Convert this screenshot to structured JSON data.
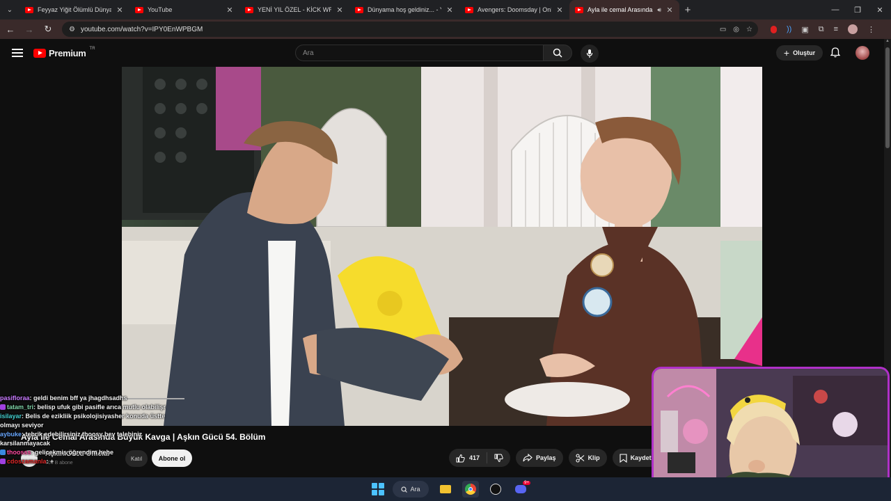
{
  "browser": {
    "tabs": [
      {
        "title": "Feyyaz Yiğit Ölümlü Dünya Sah",
        "active": false
      },
      {
        "title": "YouTube",
        "active": false
      },
      {
        "title": "YENİ YIL ÖZEL - KİCK WRAPPED",
        "active": false
      },
      {
        "title": "Dünyama hoş geldiniz... - YouTu",
        "active": false
      },
      {
        "title": "Avengers: Doomsday | Only in",
        "active": false
      },
      {
        "title": "Ayla ile cemal Arasında Büy",
        "active": true
      }
    ],
    "url": "youtube.com/watch?v=IPY0EnWPBGM"
  },
  "youtube": {
    "logo_text": "Premium",
    "region": "TR",
    "search_placeholder": "Ara",
    "create_label": "Oluştur"
  },
  "video": {
    "title": "Ayla ile Cemal Arasında Büyük Kavga | Aşkın Gücü 54. Bölüm",
    "channel": "Aşkın Gücü Official",
    "subscribers": "806 B abone",
    "join_label": "Katıl",
    "subscribe_label": "Abone ol",
    "likes": "417",
    "share_label": "Paylaş",
    "clip_label": "Klip",
    "save_label": "Kaydet"
  },
  "chat": [
    {
      "user": "pasifloraa",
      "text": ": geldi benim bff ya jhagdhsadhs",
      "color": "#c97bff"
    },
    {
      "user": "tatam_tri",
      "text": ": belisp ufuk gibi pasifle arıca mutlu olabilişr",
      "color": "#7fd4a8"
    },
    {
      "user": "isilayar",
      "text": ": Belis de ezikliik psikolojisiyasher konuda üstte olmayı seviyor",
      "color": "#44d0d0"
    },
    {
      "user": "aybuke",
      "text": ": tebrik edebilirsiniz thoosy bey talebiniz karsilanmayacak",
      "color": "#6aa8ff"
    },
    {
      "user": "thoosss",
      "text": ": gelicekmiş öğrendim hehe",
      "color": "#ff4aa0"
    },
    {
      "user": "cdoszamanla",
      "text": ": +",
      "color": "#e02828"
    }
  ],
  "taskbar": {
    "search_label": "Ara",
    "discord_badge": "9+"
  },
  "colors": {
    "accent_red": "#ff0000",
    "webcam_border": "#b030c8",
    "bg": "#0f0f0f"
  }
}
